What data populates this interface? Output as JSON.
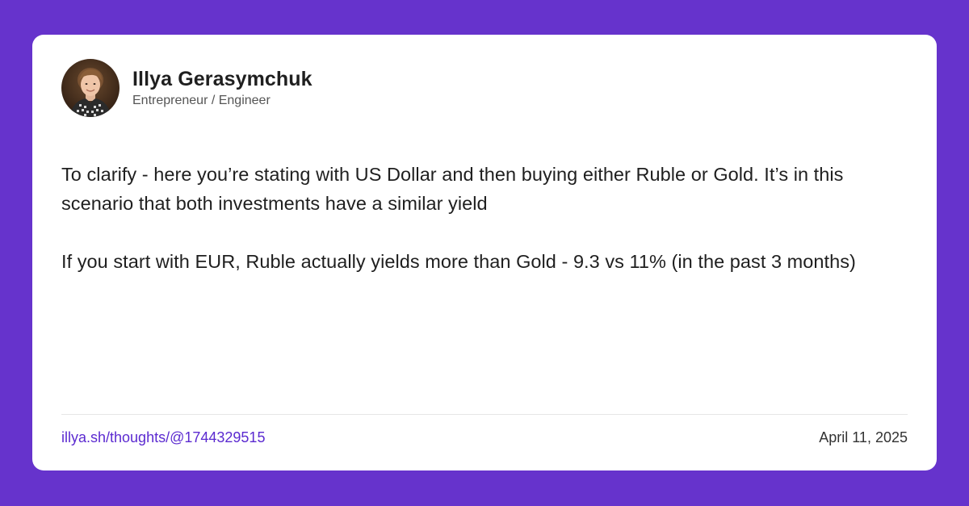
{
  "colors": {
    "background": "#6633cc",
    "card": "#ffffff",
    "link": "#5b2ad0",
    "text": "#1f1f1f"
  },
  "author": {
    "name": "Illya Gerasymchuk",
    "role": "Entrepreneur / Engineer",
    "avatar_icon": "profile-photo"
  },
  "post": {
    "paragraphs": [
      "To clarify - here you’re stating with US Dollar and then buying either Ruble or Gold. It’s in this scenario that both investments have a similar yield",
      "If you start with EUR, Ruble actually yields more than Gold - 9.3 vs 11% (in the past 3 months)"
    ]
  },
  "footer": {
    "link": "illya.sh/thoughts/@1744329515",
    "date": "April 11, 2025"
  }
}
